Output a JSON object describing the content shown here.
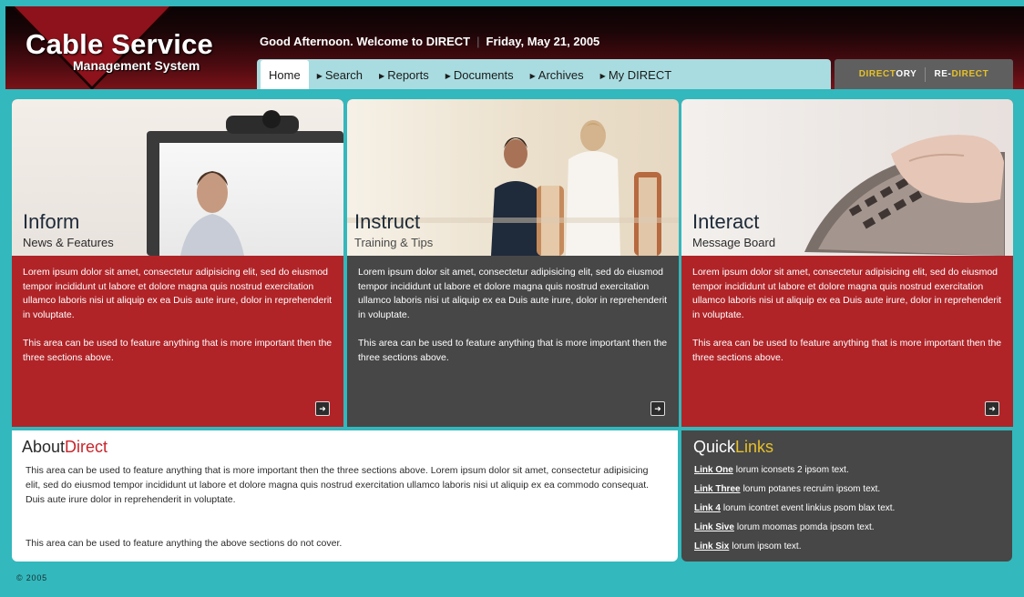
{
  "header": {
    "logo_title": "Cable Service",
    "logo_subtitle": "Management System",
    "greeting": "Good Afternoon. Welcome to DIRECT",
    "date": "Friday, May 21, 2005"
  },
  "nav": {
    "items": [
      {
        "label": "Home",
        "active": true
      },
      {
        "label": "Search",
        "active": false
      },
      {
        "label": "Reports",
        "active": false
      },
      {
        "label": "Documents",
        "active": false
      },
      {
        "label": "Archives",
        "active": false
      },
      {
        "label": "My DIRECT",
        "active": false
      }
    ]
  },
  "directory_bar": {
    "directory_a": "DIRECT",
    "directory_b": "ORY",
    "redirect_a": "RE-",
    "redirect_b": "DIRECT"
  },
  "panels": [
    {
      "title": "Inform",
      "subtitle": "News & Features",
      "body1": "Lorem ipsum dolor sit amet, consectetur adipisicing elit, sed do eiusmod tempor incididunt ut labore et dolore magna quis nostrud exercitation ullamco laboris nisi ut aliquip ex ea Duis aute irure, dolor in reprehenderit in voluptate.",
      "body2": "This area can be used to feature anything that is more important then the three sections above.",
      "image_icon": "video-conference-image",
      "color": "#b02428"
    },
    {
      "title": "Instruct",
      "subtitle": "Training & Tips",
      "body1": "Lorem ipsum dolor sit amet, consectetur adipisicing elit, sed do eiusmod tempor incididunt ut labore et dolore magna quis nostrud exercitation ullamco laboris nisi ut aliquip ex ea Duis aute irure, dolor in reprehenderit in voluptate.",
      "body2": "This area can be used to feature anything that is more important then the three sections above.",
      "image_icon": "training-room-image",
      "color": "#474747"
    },
    {
      "title": "Interact",
      "subtitle": "Message Board",
      "body1": "Lorem ipsum dolor sit amet, consectetur adipisicing elit, sed do eiusmod tempor incididunt ut labore et dolore magna quis nostrud exercitation ullamco laboris nisi ut aliquip ex ea Duis aute irure, dolor in reprehenderit in voluptate.",
      "body2": "This area can be used to feature anything that is more important then the three sections above.",
      "image_icon": "keyboard-hands-image",
      "color": "#b02428"
    }
  ],
  "about": {
    "title_a": "About",
    "title_b": "Direct",
    "p1": "This area can be used to feature anything that is more important then the three sections above. Lorem ipsum dolor sit amet, consectetur adipisicing elit, sed do eiusmod tempor incididunt ut labore et dolore magna quis nostrud exercitation ullamco laboris nisi ut aliquip ex ea commodo consequat. Duis aute irure dolor in reprehenderit in voluptate.",
    "p2": "This area can be used to feature anything the above sections do not cover."
  },
  "quicklinks": {
    "title_a": "Quick",
    "title_b": "Links",
    "items": [
      {
        "link": "Link One",
        "text": "lorum iconsets 2 ipsom text."
      },
      {
        "link": "Link Three",
        "text": "lorum potanes recruim ipsom text."
      },
      {
        "link": "Link 4",
        "text": "lorum icontret event linkius psom blax text."
      },
      {
        "link": "Link Sive",
        "text": "lorum moomas pomda ipsom text."
      },
      {
        "link": "Link Six",
        "text": "lorum ipsom text."
      }
    ]
  },
  "footer": {
    "copyright": "© 2005"
  },
  "colors": {
    "accent_red": "#b02428",
    "panel_dark": "#474747",
    "background_teal": "#32b8bd",
    "nav_light": "#a9dce0",
    "yellow": "#e6c02a"
  }
}
